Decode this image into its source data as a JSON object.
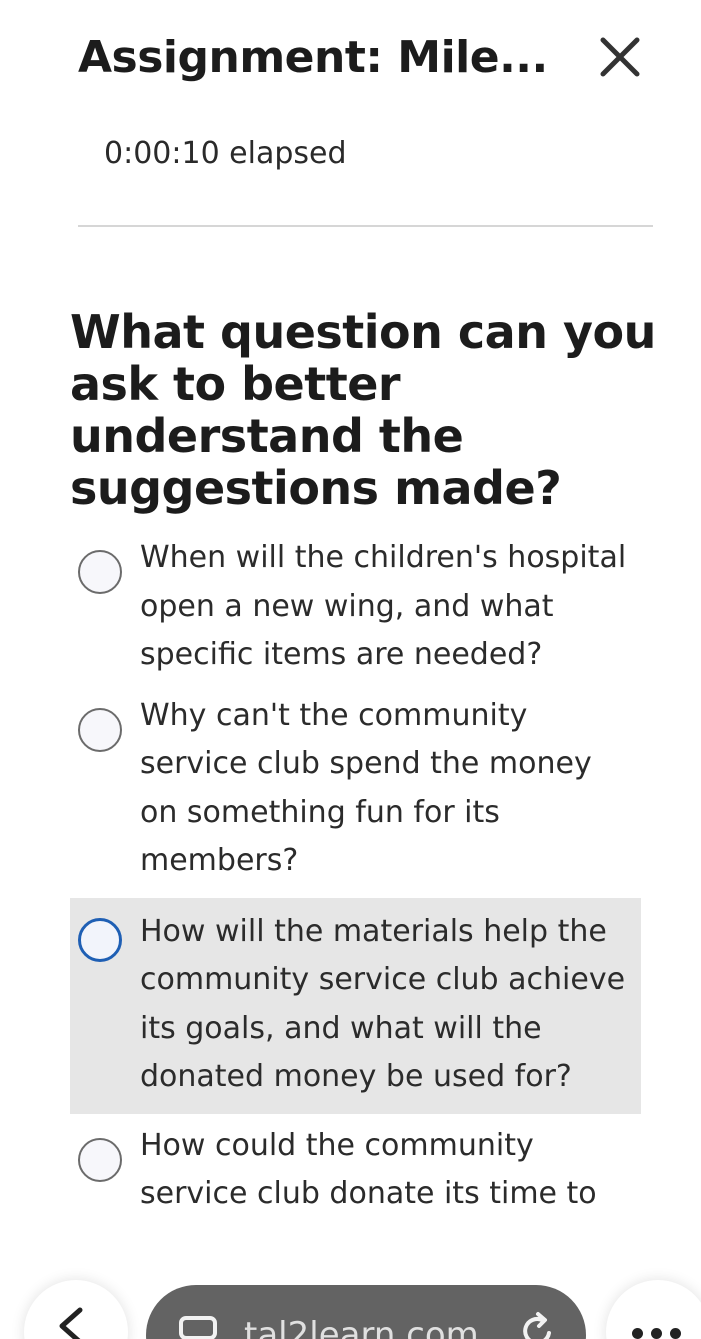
{
  "header": {
    "title": "Assignment: Mile...",
    "close_icon": "close-icon"
  },
  "timer": {
    "text": "0:00:10 elapsed"
  },
  "question": {
    "text": "What question can you ask to better understand the suggestions made?"
  },
  "choices": [
    {
      "text": "When will the children's hospital open a new wing, and what specific items are needed?",
      "selected": false,
      "highlighted": false
    },
    {
      "text": "Why can't the community service club spend the money on something fun for its members?",
      "selected": false,
      "highlighted": false
    },
    {
      "text": "How will the materials help the community service club achieve its goals, and what will the donated money be used for?",
      "selected": false,
      "highlighted": true
    },
    {
      "text": "How could the community service club donate its time to the hospital for additional",
      "selected": false,
      "highlighted": false
    }
  ],
  "browser_bar": {
    "url": "tal2learn.com",
    "back_icon": "chevron-left-icon",
    "tabs_icon": "tabs-icon",
    "reload_icon": "reload-icon",
    "more_icon": "more-icon"
  },
  "colors": {
    "accent": "#1f5fb4",
    "highlight_bg": "#e6e6e6",
    "pill_bg": "#636363"
  }
}
